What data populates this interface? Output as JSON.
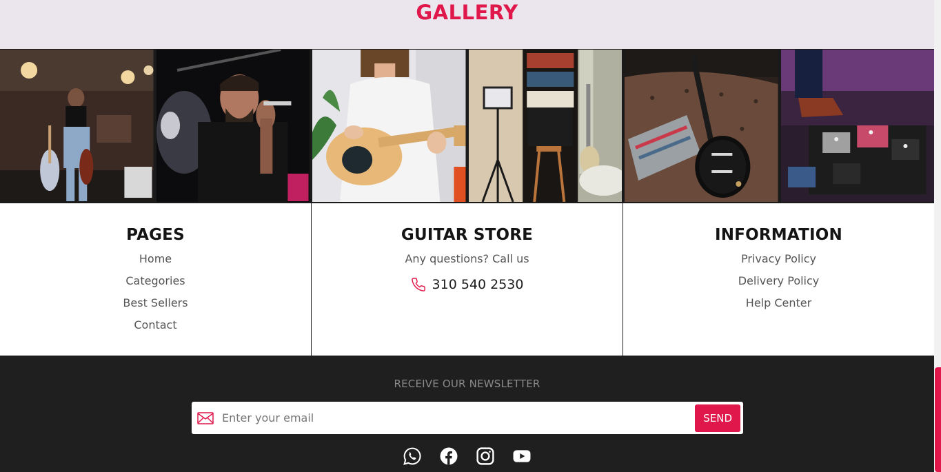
{
  "gallery": {
    "title": "GALLERY",
    "images": [
      {
        "name": "guitarist-woman-image"
      },
      {
        "name": "harmonica-singer-image"
      },
      {
        "name": "woman-playing-guitar-image"
      },
      {
        "name": "home-studio-image"
      },
      {
        "name": "guitar-on-couch-image"
      },
      {
        "name": "guitar-pedals-image"
      }
    ]
  },
  "pages_column": {
    "heading": "PAGES",
    "links": [
      "Home",
      "Categories",
      "Best Sellers",
      "Contact"
    ]
  },
  "store_column": {
    "heading": "GUITAR STORE",
    "subtitle": "Any questions? Call us",
    "phone": "310 540 2530",
    "phone_icon": "phone-icon"
  },
  "info_column": {
    "heading": "INFORMATION",
    "links": [
      "Privacy Policy",
      "Delivery Policy",
      "Help Center"
    ]
  },
  "newsletter": {
    "label": "RECEIVE OUR NEWSLETTER",
    "placeholder": "Enter your email",
    "send_label": "SEND",
    "icon": "mail-icon"
  },
  "social": [
    "whatsapp-icon",
    "facebook-icon",
    "instagram-icon",
    "youtube-icon"
  ],
  "colors": {
    "accent": "#e0174a",
    "header_bg": "#ebe6ee",
    "footer_bg": "#1f1f1f"
  }
}
